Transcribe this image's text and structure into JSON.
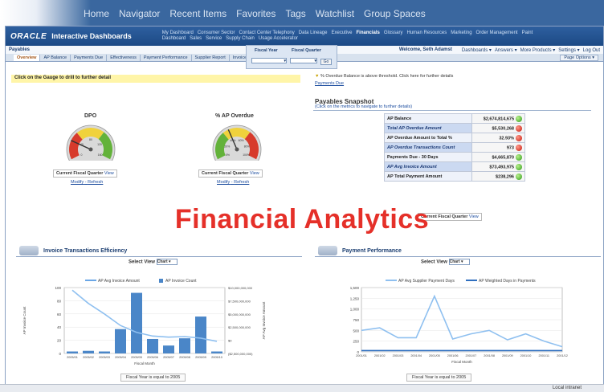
{
  "top_nav": [
    "Home",
    "Navigator",
    "Recent Items",
    "Favorites",
    "Tags",
    "Watchlist",
    "Group Spaces"
  ],
  "brand": {
    "logo": "ORACLE",
    "name": "Interactive Dashboards"
  },
  "modules": [
    "My Dashboard",
    "Consumer Sector",
    "Contact Center Telephony",
    "Data Lineage",
    "Executive",
    "Financials",
    "Glossary",
    "Human Resources",
    "Marketing",
    "Order Management",
    "Paint Dashboard",
    "Sales",
    "Service",
    "Supply Chain",
    "Usage Accelerator"
  ],
  "subbar": {
    "page": "Payables",
    "welcome": "Welcome, Seth Adamst",
    "links": [
      "Dashboards ▾",
      "Answers ▾",
      "More Products ▾",
      "Settings ▾",
      "Log Out"
    ]
  },
  "tabs": [
    "Overview",
    "AP Balance",
    "Payments Due",
    "Effectiveness",
    "Payment Performance",
    "Supplier Report",
    "Invoice Details",
    "All AP Transactions"
  ],
  "page_options": "Page Options ▾",
  "prompt": {
    "year_label": "Fiscal Year",
    "quarter_label": "Fiscal Quarter",
    "go": "Go"
  },
  "gauge_hint": "Click on the Gauge to drill to further detail",
  "gauges": [
    {
      "title": "DPO",
      "value_pct": 0.22,
      "ticks": [
        "0",
        "40",
        "80",
        "120",
        "160"
      ],
      "box": "Current Fiscal Quarter",
      "view": "View",
      "links": [
        "Modify",
        "Refresh"
      ]
    },
    {
      "title": "% AP Overdue",
      "value_pct": 0.4,
      "ticks": [
        "0%",
        "20%",
        "40%",
        "60%",
        "80%",
        "100%"
      ],
      "box": "Current Fiscal Quarter",
      "view": "View",
      "links": [
        "Modify",
        "Refresh"
      ]
    }
  ],
  "notice": "% Overdue Balance is above threshold. Click here for further details",
  "payments_due_link": "Payments Due",
  "snapshot": {
    "title": "Payables Snapshot",
    "subtitle": "(Click on the metrics to navigate to further details)",
    "rows": [
      {
        "label": "AP Balance",
        "value": "$2,674,814,675",
        "status": "green"
      },
      {
        "label": "Total AP Overdue Amount",
        "value": "$5,530,268",
        "status": "red"
      },
      {
        "label": "AP Overdue Amount to Total %",
        "value": "32.93%",
        "status": "red"
      },
      {
        "label": "AP Overdue Transactions Count",
        "value": "973",
        "status": "red"
      },
      {
        "label": "Payments Due - 30 Days",
        "value": "$4,665,870",
        "status": "green"
      },
      {
        "label": "AP Avg Invoice Amount",
        "value": "$73,493,975",
        "status": "green"
      },
      {
        "label": "AP Total Payment Amount",
        "value": "$238,296",
        "status": "green"
      }
    ],
    "footer_box": "Current Fiscal Quarter",
    "footer_view": "View"
  },
  "overlay_title": "Financial Analytics",
  "sections": [
    {
      "title": "Invoice Transactions Efficiency",
      "select_view": "Select View",
      "view_value": "Chart",
      "footer": "Fiscal Year is equal to 2005"
    },
    {
      "title": "Payment Performance",
      "select_view": "Select View",
      "view_value": "Chart",
      "footer": "Fiscal Year is equal to 2005"
    }
  ],
  "status_bar": "Local intranet",
  "chart_data": [
    {
      "type": "bar",
      "legend": [
        "AP Avg Invoice Amount",
        "AP Invoice Count"
      ],
      "categories": [
        "2005/01",
        "2005/02",
        "2005/03",
        "2005/04",
        "2005/05",
        "2005/06",
        "2005/07",
        "2005/08",
        "2005/09",
        "2005/10"
      ],
      "series": [
        {
          "name": "AP Invoice Count",
          "values": [
            3,
            4,
            3,
            37,
            92,
            22,
            12,
            23,
            56,
            3
          ]
        },
        {
          "name": "AP Avg Invoice Amount",
          "values": [
            9.5,
            7.0,
            5.0,
            2.8,
            1.5,
            0.8,
            0.6,
            0.7,
            0.4,
            -0.2
          ]
        }
      ],
      "ylabel_left": "AP Invoice Count",
      "ylabel_right": "AP Avg Invoice Amount",
      "yticks_left": [
        "0",
        "20",
        "40",
        "60",
        "80",
        "100"
      ],
      "yticks_right": [
        "($2,500,000,000)",
        "$0",
        "$2,500,000,000",
        "$5,000,000,000",
        "$7,500,000,000",
        "$10,000,000,000"
      ],
      "xlabel": "Fiscal Month"
    },
    {
      "type": "line",
      "legend": [
        "AP Avg Supplier Payment Days",
        "AP Weighted Days in Payments"
      ],
      "categories": [
        "2001/01",
        "2001/02",
        "2001/03",
        "2001/04",
        "2001/05",
        "2001/06",
        "2001/07",
        "2001/08",
        "2001/09",
        "2001/10",
        "2001/11",
        "2001/12"
      ],
      "series": [
        {
          "name": "AP Avg Supplier Payment Days",
          "values": [
            500,
            560,
            330,
            330,
            1300,
            300,
            420,
            500,
            280,
            420,
            250,
            120
          ]
        },
        {
          "name": "AP Weighted Days in Payments",
          "values": [
            30,
            30,
            30,
            30,
            30,
            30,
            30,
            30,
            30,
            30,
            30,
            30
          ]
        }
      ],
      "yticks": [
        "0",
        "250",
        "500",
        "750",
        "1,000",
        "1,250",
        "1,500"
      ],
      "xlabel": "Fiscal Month"
    }
  ]
}
